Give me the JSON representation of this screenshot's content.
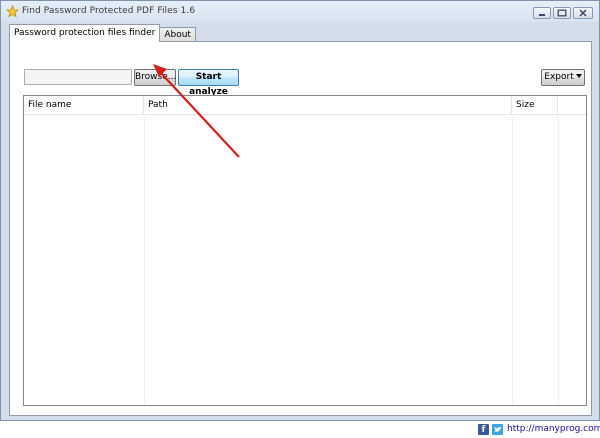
{
  "window": {
    "title": "Find Password Protected PDF Files 1.6",
    "controls": [
      "minimize",
      "maximize",
      "close"
    ]
  },
  "tabs": [
    {
      "label": "Password protection files finder",
      "active": true
    },
    {
      "label": "About",
      "active": false
    }
  ],
  "toolbar": {
    "path_value": "",
    "browse_label": "Browse...",
    "analyze_label": "Start analyze",
    "export_label": "Export"
  },
  "table": {
    "columns": [
      "File name",
      "Path",
      "Size",
      ""
    ],
    "rows": []
  },
  "footer": {
    "facebook_glyph": "f",
    "link_text": "http://manyprog.com"
  },
  "colors": {
    "accent_annotation": "#d41f1f",
    "facebook": "#3b5998",
    "twitter": "#3aa7e2",
    "link": "#1a0dab"
  },
  "icons": [
    "app-star-icon",
    "minimize-icon",
    "maximize-icon",
    "close-icon",
    "facebook-icon",
    "twitter-icon",
    "dropdown-caret-icon",
    "annotation-arrow-icon"
  ]
}
